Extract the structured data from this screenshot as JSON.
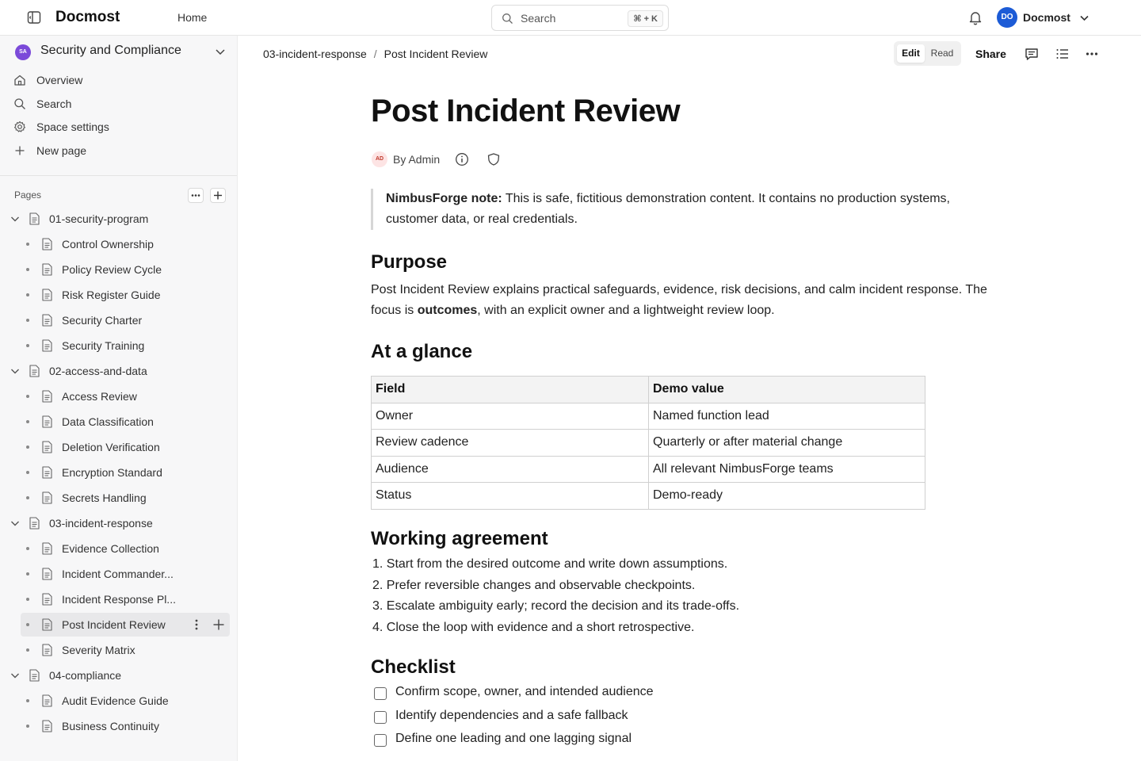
{
  "header": {
    "brand": "Docmost",
    "home_label": "Home",
    "search_label": "Search",
    "search_shortcut": "⌘ + K",
    "user_initials": "DO",
    "user_name": "Docmost",
    "accent_color": "#1c5bd6"
  },
  "sidebar": {
    "space_initials": "SA",
    "space_name": "Security and Compliance",
    "space_color": "#7b4ad9",
    "nav": [
      {
        "label": "Overview",
        "icon": "home-icon"
      },
      {
        "label": "Search",
        "icon": "search-icon"
      },
      {
        "label": "Space settings",
        "icon": "gear-icon"
      },
      {
        "label": "New page",
        "icon": "plus-icon"
      }
    ],
    "pages_label": "Pages",
    "tree": [
      {
        "label": "01-security-program",
        "level": 0
      },
      {
        "label": "Control Ownership",
        "level": 1
      },
      {
        "label": "Policy Review Cycle",
        "level": 1
      },
      {
        "label": "Risk Register Guide",
        "level": 1
      },
      {
        "label": "Security Charter",
        "level": 1
      },
      {
        "label": "Security Training",
        "level": 1
      },
      {
        "label": "02-access-and-data",
        "level": 0
      },
      {
        "label": "Access Review",
        "level": 1
      },
      {
        "label": "Data Classification",
        "level": 1
      },
      {
        "label": "Deletion Verification",
        "level": 1
      },
      {
        "label": "Encryption Standard",
        "level": 1
      },
      {
        "label": "Secrets Handling",
        "level": 1
      },
      {
        "label": "03-incident-response",
        "level": 0
      },
      {
        "label": "Evidence Collection",
        "level": 1
      },
      {
        "label": "Incident Commander...",
        "level": 1
      },
      {
        "label": "Incident Response Pl...",
        "level": 1
      },
      {
        "label": "Post Incident Review",
        "level": 1,
        "active": true
      },
      {
        "label": "Severity Matrix",
        "level": 1
      },
      {
        "label": "04-compliance",
        "level": 0
      },
      {
        "label": "Audit Evidence Guide",
        "level": 1
      },
      {
        "label": "Business Continuity",
        "level": 1
      }
    ]
  },
  "toolbar": {
    "breadcrumb": [
      "03-incident-response",
      "Post Incident Review"
    ],
    "edit_label": "Edit",
    "read_label": "Read",
    "share_label": "Share"
  },
  "document": {
    "title": "Post Incident Review",
    "author_initials": "AD",
    "author_label": "By Admin",
    "callout_bold": "NimbusForge note:",
    "callout_text": " This is safe, fictitious demonstration content. It contains no production systems, customer data, or real credentials.",
    "purpose_heading": "Purpose",
    "purpose_text_1": "Post Incident Review explains practical safeguards, evidence, risk decisions, and calm incident response. The focus is ",
    "purpose_bold": "outcomes",
    "purpose_text_2": ", with an explicit owner and a lightweight review loop.",
    "glance_heading": "At a glance",
    "table": {
      "headers": [
        "Field",
        "Demo value"
      ],
      "rows": [
        [
          "Owner",
          "Named function lead"
        ],
        [
          "Review cadence",
          "Quarterly or after material change"
        ],
        [
          "Audience",
          "All relevant NimbusForge teams"
        ],
        [
          "Status",
          "Demo-ready"
        ]
      ]
    },
    "agreement_heading": "Working agreement",
    "agreement_items": [
      "1. Start from the desired outcome and write down assumptions.",
      "2. Prefer reversible changes and observable checkpoints.",
      "3. Escalate ambiguity early; record the decision and its trade-offs.",
      "4. Close the loop with evidence and a short retrospective."
    ],
    "checklist_heading": "Checklist",
    "checklist_items": [
      {
        "label": "Confirm scope, owner, and intended audience",
        "checked": false
      },
      {
        "label": "Identify dependencies and a safe fallback",
        "checked": false
      },
      {
        "label": "Define one leading and one lagging signal",
        "checked": false
      }
    ]
  }
}
